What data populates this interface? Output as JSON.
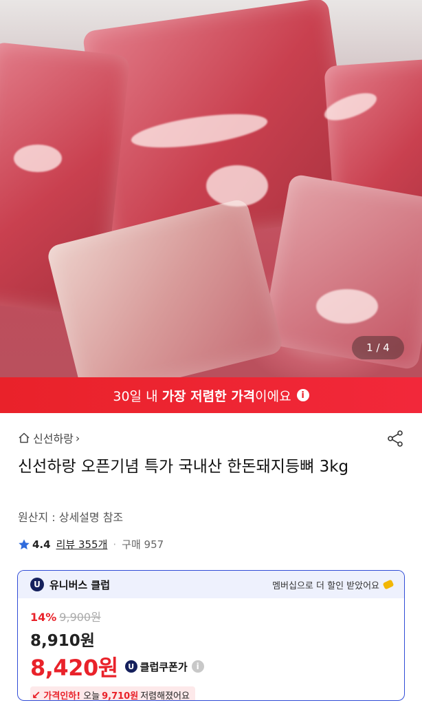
{
  "hero": {
    "page_indicator": "1 / 4"
  },
  "banner": {
    "prefix": "30일 내",
    "highlight": "가장 저렴한 가격",
    "suffix": "이에요",
    "info_icon": "i"
  },
  "store": {
    "name": "신선하랑",
    "chevron": "›"
  },
  "product": {
    "title": "신선하랑 오픈기념 특가 국내산 한돈돼지등뼈 3kg",
    "origin": "원산지 : 상세설명 참조"
  },
  "rating": {
    "score": "4.4",
    "reviews": "리뷰 355개",
    "dot": "·",
    "purchases": "구매 957"
  },
  "club": {
    "badge": "U",
    "name": "유니버스 클럽",
    "member_note": "멤버십으로 더 할인 받았어요",
    "discount_percent": "14%",
    "original_price": "9,900원",
    "sale_price": "8,910원",
    "club_price": "8,420원",
    "coupon_label": "클럽쿠폰가",
    "help_icon": "i",
    "drop_prefix": "가격인하!",
    "drop_today": "오늘",
    "drop_amount": "9,710원",
    "drop_suffix": "저렴해졌어요"
  },
  "colors": {
    "accent_red": "#e9222a",
    "club_blue": "#2f4bd6",
    "club_navy": "#15205c"
  }
}
